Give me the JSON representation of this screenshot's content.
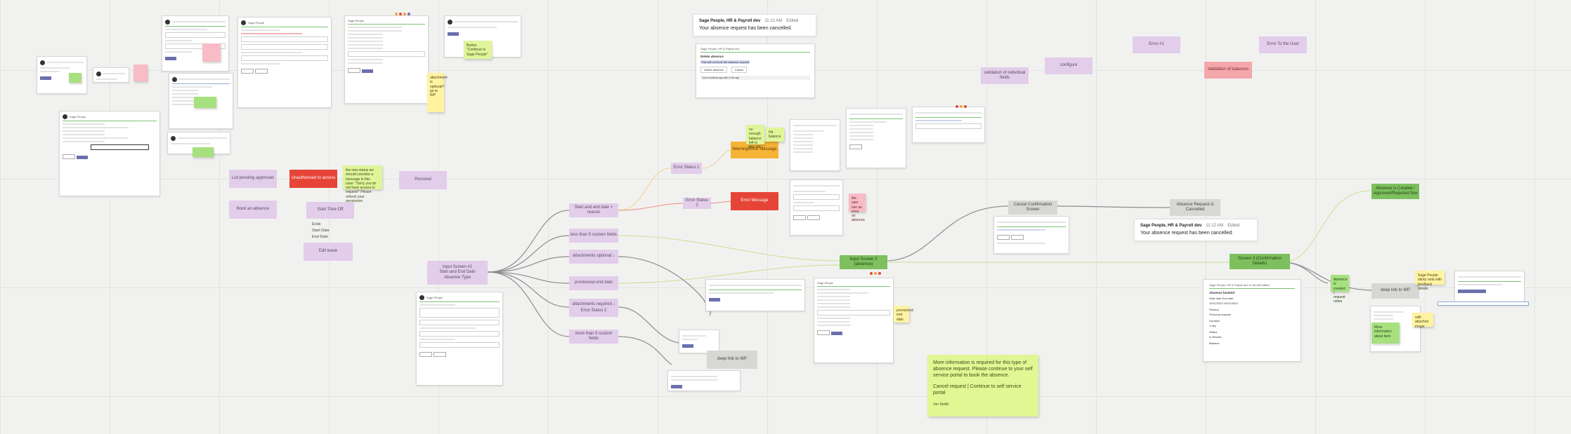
{
  "flow_nodes": {
    "input_screen": "Input Screen #1\nStart and End Date\nAbsence Type",
    "start_end_entries": "Start and end date + reason",
    "less_than_5": "less than 5 custom fields",
    "attachments_optional": "attachments optional ↓",
    "provisional_end_date": "provisional end date",
    "attachments_required": "attachments required ↓",
    "error_status_2_inline": "Error Status 2",
    "more_than_5": "more than 5 custom fields",
    "error_status_1": "Error Status 1",
    "warning_msg": "Warning/Error Message",
    "error_status_2": "Error Status 2",
    "error_message": "Error Message",
    "input_screen_2": "Input Screen 2 (absence)",
    "cancel_confirmation": "Cancel Confirmation Screen",
    "absence_cancelled": "Absence Request is Cancelled",
    "confirmation_screen": "Screen 3 (Confirmation Details)",
    "absence_approved": "Absence is Created / Approved/Rejected flow",
    "deep_link_wp": "deep link to WP",
    "deep_link_wp_2": "deep link to WP"
  },
  "left_nodes": {
    "pending_approvals": "List pending approvals",
    "unauthorised": "Unauthorised to access",
    "personal": "Personal",
    "book_absence": "Book an absence",
    "start_time_off": "Start Time Off",
    "edit_leave": "Edit leave"
  },
  "top_right_nodes": {
    "validation_of_fields": "validation of individual fields",
    "configure": "configure",
    "error_1": "Error #1",
    "error_to_user": "Error To the User",
    "validation_of_balances": "Validation of balances"
  },
  "plain_labels": [
    "Ends",
    "Start Date",
    "End Date"
  ],
  "stickies": {
    "s_nav_sage": "Button \"Continue to Sage People\"",
    "s_login": "the new status we should consider a message in this case: \"Sorry you do not have access to request!\" Please refresh your permission",
    "s_attach": "attachment is optional? go to WP",
    "s_error": "the user see an error on absence",
    "s_pink_screen": "cannot submit request from app",
    "s_warning_note": "no enough balance left to pay out",
    "s_balance": "Hit balance",
    "s_right_yellow": "Sage People sticky note with feedback details",
    "s_right_yellow_2": "with attached image",
    "s_screen3": "provisional end date",
    "s_small_green": "Sage People flow note",
    "s_small_green_2": "More information about item",
    "s_confirmation": "Absence is created / request notes"
  },
  "big_sticky": {
    "line1": "More information is required for this type of absence request. Please continue to your self service portal to book the absence.",
    "line2": "Cancel request | Continue to self service portal",
    "author": "Jon Smith"
  },
  "toasts": {
    "t_top": {
      "sender": "Sage People, HR & Payroll dev",
      "time": "11:12 AM",
      "edited": "Edited",
      "message": "Your absence request has been cancelled."
    },
    "t_mid": {
      "sender": "Sage People, HR & Payroll dev",
      "time": "11:12 AM",
      "edited": "Edited",
      "message": "Your absence request has been cancelled."
    }
  },
  "cancel_dialog": {
    "header": "Sage People, HR & Payroll dev",
    "title": "Delete absence",
    "body": "This will not book the absence request",
    "delete_label": "Delete absence",
    "cancel_label": "Cancel",
    "footer": "Your functional app with in the app"
  },
  "summary_card": {
    "header": "Sage People, HR & Payroll dev   11:06 AM  Edited",
    "title": "Absence booked",
    "rows": [
      "Start date   End date",
      "10/11/2023   10/11/2023",
      "Reason",
      "Personal reasons",
      "Duration",
      "1 day",
      "Status",
      "In Review",
      "Balance"
    ]
  },
  "colors": {
    "purple": "#e2cdea",
    "green": "#7dc05d",
    "red": "#e64437",
    "orange": "#f7b335",
    "salmon": "#f3a7ab",
    "gray": "#d7d8d5",
    "sticky_lime": "#dff59a",
    "sticky_yellow": "#fff3a2",
    "sticky_pink": "#f8bcc6",
    "connector": "#8d8d8d",
    "accent": "#6b6fae",
    "header_green": "#7cc274"
  }
}
